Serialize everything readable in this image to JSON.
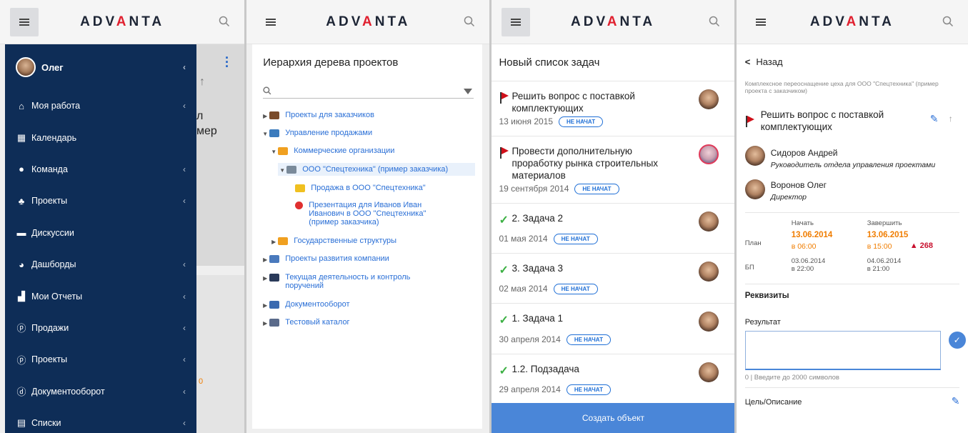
{
  "brand": {
    "logo": "ADVANTA"
  },
  "screen1": {
    "user_name": "Олег",
    "menu": [
      {
        "label": "Моя работа",
        "icon": "home-icon",
        "glyph": "⌂",
        "chevron": true
      },
      {
        "label": "Календарь",
        "icon": "calendar-icon",
        "glyph": "▦",
        "chevron": false
      },
      {
        "label": "Команда",
        "icon": "team-icon",
        "glyph": "●",
        "chevron": true
      },
      {
        "label": "Проекты",
        "icon": "hierarchy-icon",
        "glyph": "♣",
        "chevron": true
      },
      {
        "label": "Дискуссии",
        "icon": "chat-icon",
        "glyph": "▬",
        "chevron": false
      },
      {
        "label": "Дашборды",
        "icon": "dashboard-icon",
        "glyph": "◕",
        "chevron": true
      },
      {
        "label": "Мои Отчеты",
        "icon": "reports-icon",
        "glyph": "▟",
        "chevron": true
      },
      {
        "label": "Продажи",
        "icon": "p-circle-icon",
        "glyph": "ⓟ",
        "chevron": true
      },
      {
        "label": "Проекты",
        "icon": "p-circle-icon",
        "glyph": "ⓟ",
        "chevron": true
      },
      {
        "label": "Документооборот",
        "icon": "d-circle-icon",
        "glyph": "ⓓ",
        "chevron": true
      },
      {
        "label": "Списки",
        "icon": "list-icon",
        "glyph": "▤",
        "chevron": true
      }
    ],
    "bg_text_1": "л",
    "bg_text_2": "мер",
    "bg_text_3": "0"
  },
  "screen2": {
    "title": "Иерархия дерева проектов",
    "tree": [
      {
        "label": "Проекты для заказчиков",
        "tri": "▶",
        "color": "#7a4b2a"
      },
      {
        "label": "Управление продажами",
        "tri": "▼",
        "color": "#3b7bbd"
      },
      {
        "label": "Коммерческие организации",
        "tri": "▼",
        "color": "#f0a020"
      },
      {
        "label": "ООО \"Спецтехника\" (пример заказчика)",
        "tri": "▼",
        "color": "#7a8a9a"
      },
      {
        "label": "Продажа в ООО \"Спецтехника\"",
        "tri": "",
        "color": "#f0c020"
      },
      {
        "label": "Презентация для Иванов Иван Иванович в ООО \"Спецтехника\" (пример заказчика)",
        "tri": "",
        "color": "#e03030"
      },
      {
        "label": "Государственные структуры",
        "tri": "▶",
        "color": "#f0a020"
      },
      {
        "label": "Проекты развития компании",
        "tri": "▶",
        "color": "#4a7abd"
      },
      {
        "label": "Текущая деятельность и контроль поручений",
        "tri": "▶",
        "color": "#2a3a5a"
      },
      {
        "label": "Документооборот",
        "tri": "▶",
        "color": "#3a6ab0"
      },
      {
        "label": "Тестовый каталог",
        "tri": "▶",
        "color": "#5a6a8a"
      }
    ]
  },
  "screen3": {
    "title": "Новый список задач",
    "tasks": [
      {
        "title": "Решить вопрос с поставкой комплектующих",
        "date": "13 июня 2015",
        "status": "НЕ НАЧАТ",
        "mark": "flag"
      },
      {
        "title": "Провести дополнительную проработку рынка строительных материалов",
        "date": "19 сентября 2014",
        "status": "НЕ НАЧАТ",
        "mark": "flag"
      },
      {
        "title": "2. Задача 2",
        "date": "01 мая 2014",
        "status": "НЕ НАЧАТ",
        "mark": "check"
      },
      {
        "title": "3. Задача 3",
        "date": "02 мая 2014",
        "status": "НЕ НАЧАТ",
        "mark": "check"
      },
      {
        "title": "1. Задача 1",
        "date": "30 апреля 2014",
        "status": "НЕ НАЧАТ",
        "mark": "check"
      },
      {
        "title": "1.2. Подзадача",
        "date": "29 апреля 2014",
        "status": "НЕ НАЧАТ",
        "mark": "check"
      }
    ],
    "create_button": "Создать объект"
  },
  "screen4": {
    "back": "Назад",
    "project": "Комплексное переоснащение цеха для ООО \"Спецтехника\" (пример проекта с заказчиком)",
    "task_title": "Решить вопрос с поставкой комплектующих",
    "people": [
      {
        "name": "Сидоров Андрей",
        "role": "Руководитель отдела управления проектами"
      },
      {
        "name": "Воронов Олег",
        "role": "Директор"
      }
    ],
    "col_start": "Начать",
    "col_end": "Завершить",
    "plan_label": "План",
    "plan_start_date": "13.06.2014",
    "plan_start_time": "в 06:00",
    "plan_end_date": "13.06.2015",
    "plan_end_time": "в 15:00",
    "overdue": "268",
    "bp_label": "БП",
    "bp_start_date": "03.06.2014",
    "bp_start_time": "в 22:00",
    "bp_end_date": "04.06.2014",
    "bp_end_time": "в 21:00",
    "requisites": "Реквизиты",
    "result_label": "Результат",
    "result_value": "",
    "counter": "0 | Введите до 2000 символов",
    "goal_label": "Цель/Описание",
    "accent": "#f07d00",
    "danger": "#c8102e"
  }
}
